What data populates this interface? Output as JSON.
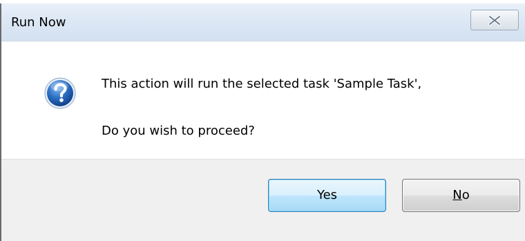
{
  "window": {
    "title": "Run Now",
    "close_icon": "close-icon"
  },
  "message": {
    "icon": "question-icon",
    "line1": "This action will run the selected task 'Sample Task',",
    "line2": "Do you wish to proceed?"
  },
  "buttons": {
    "yes_label": "Yes",
    "no_mnemonic": "N",
    "no_rest": "o"
  },
  "colors": {
    "titlebar": "#dde8f5",
    "footer": "#f0f0f0",
    "default_button_border": "#3c7fb1",
    "icon_blue": "#1f5fb0"
  }
}
